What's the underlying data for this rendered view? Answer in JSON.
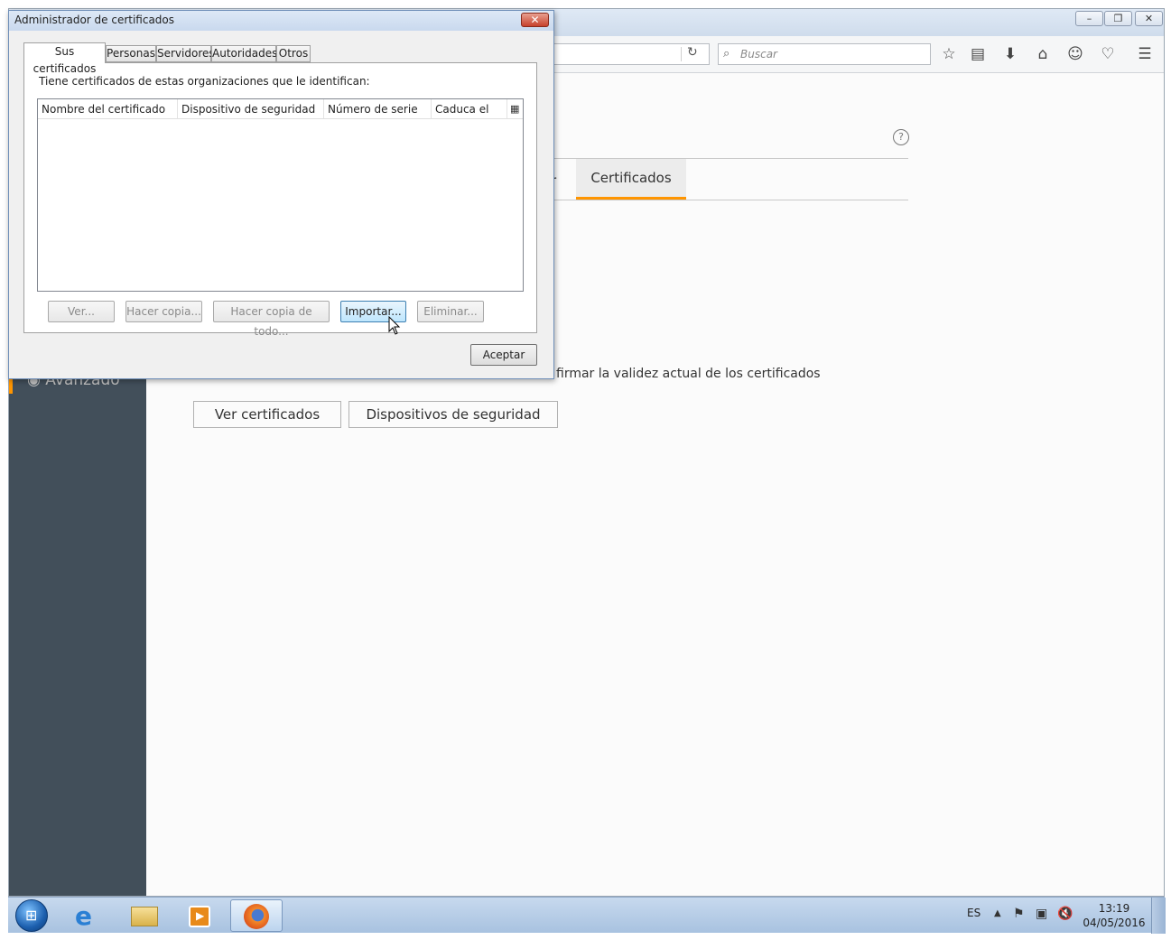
{
  "browser": {
    "search_placeholder": "Buscar",
    "content": {
      "tab_certificates": "Certificados",
      "tab_partial": "r",
      "validity_text": "firmar la validez actual de los certificados",
      "view_certs_button": "Ver certificados",
      "security_devices_button": "Dispositivos de seguridad",
      "sidebar_active_label": "Avanzado"
    }
  },
  "dialog": {
    "title": "Administrador de certificados",
    "tabs": [
      "Sus certificados",
      "Personas",
      "Servidores",
      "Autoridades",
      "Otros"
    ],
    "intro": "Tiene certificados de estas organizaciones que le identifican:",
    "columns": [
      "Nombre del certificado",
      "Dispositivo de seguridad",
      "Número de serie",
      "Caduca el"
    ],
    "buttons": {
      "view": "Ver...",
      "backup": "Hacer copia...",
      "backup_all": "Hacer copia de todo...",
      "import": "Importar...",
      "delete": "Eliminar..."
    },
    "accept": "Aceptar"
  },
  "taskbar": {
    "language": "ES",
    "time": "13:19",
    "date": "04/05/2016"
  },
  "colors": {
    "accent_orange": "#ff9500",
    "sidebar": "#424f5a",
    "taskbar": "#b9cfe9"
  }
}
